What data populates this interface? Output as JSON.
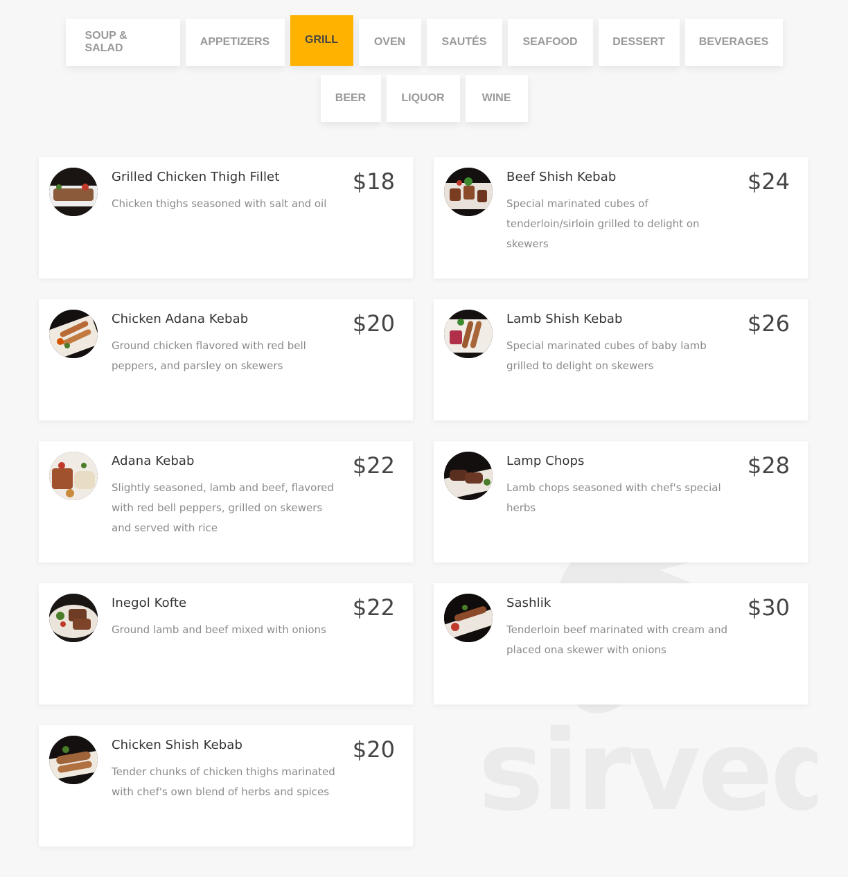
{
  "tabs": {
    "row1": [
      "SOUP & SALAD",
      "APPETIZERS",
      "GRILL",
      "OVEN",
      "SAUTÉS",
      "SEAFOOD",
      "DESSERT",
      "BEVERAGES"
    ],
    "row2": [
      "BEER",
      "LIQUOR",
      "WINE"
    ],
    "active": "GRILL",
    "active_color": "#ffb300"
  },
  "items": [
    {
      "name": "Grilled Chicken Thigh Fillet",
      "desc": "Chicken thighs seasoned with salt and oil",
      "price": "$18"
    },
    {
      "name": "Beef Shish Kebab",
      "desc": "Special marinated cubes of tenderloin/sirloin grilled to delight on skewers",
      "price": "$24"
    },
    {
      "name": "Chicken Adana Kebab",
      "desc": "Ground chicken flavored with red bell peppers, and parsley on skewers",
      "price": "$20"
    },
    {
      "name": "Lamb Shish Kebab",
      "desc": "Special marinated cubes of baby lamb grilled to delight on skewers",
      "price": "$26"
    },
    {
      "name": "Adana Kebab",
      "desc": "Slightly seasoned, lamb and beef, flavored with red bell peppers, grilled on skewers and served with rice",
      "price": "$22"
    },
    {
      "name": "Lamp Chops",
      "desc": "Lamb chops seasoned with chef's special herbs",
      "price": "$28"
    },
    {
      "name": "Inegol Kofte",
      "desc": "Ground lamb and beef mixed with onions",
      "price": "$22"
    },
    {
      "name": "Sashlik",
      "desc": "Tenderloin beef marinated with cream and placed ona skewer with onions",
      "price": "$30"
    },
    {
      "name": "Chicken Shish Kebab",
      "desc": "Tender chunks of chicken thighs marinated with chef's own blend of herbs and spices",
      "price": "$20"
    }
  ],
  "watermark": {
    "text": "sirved"
  }
}
